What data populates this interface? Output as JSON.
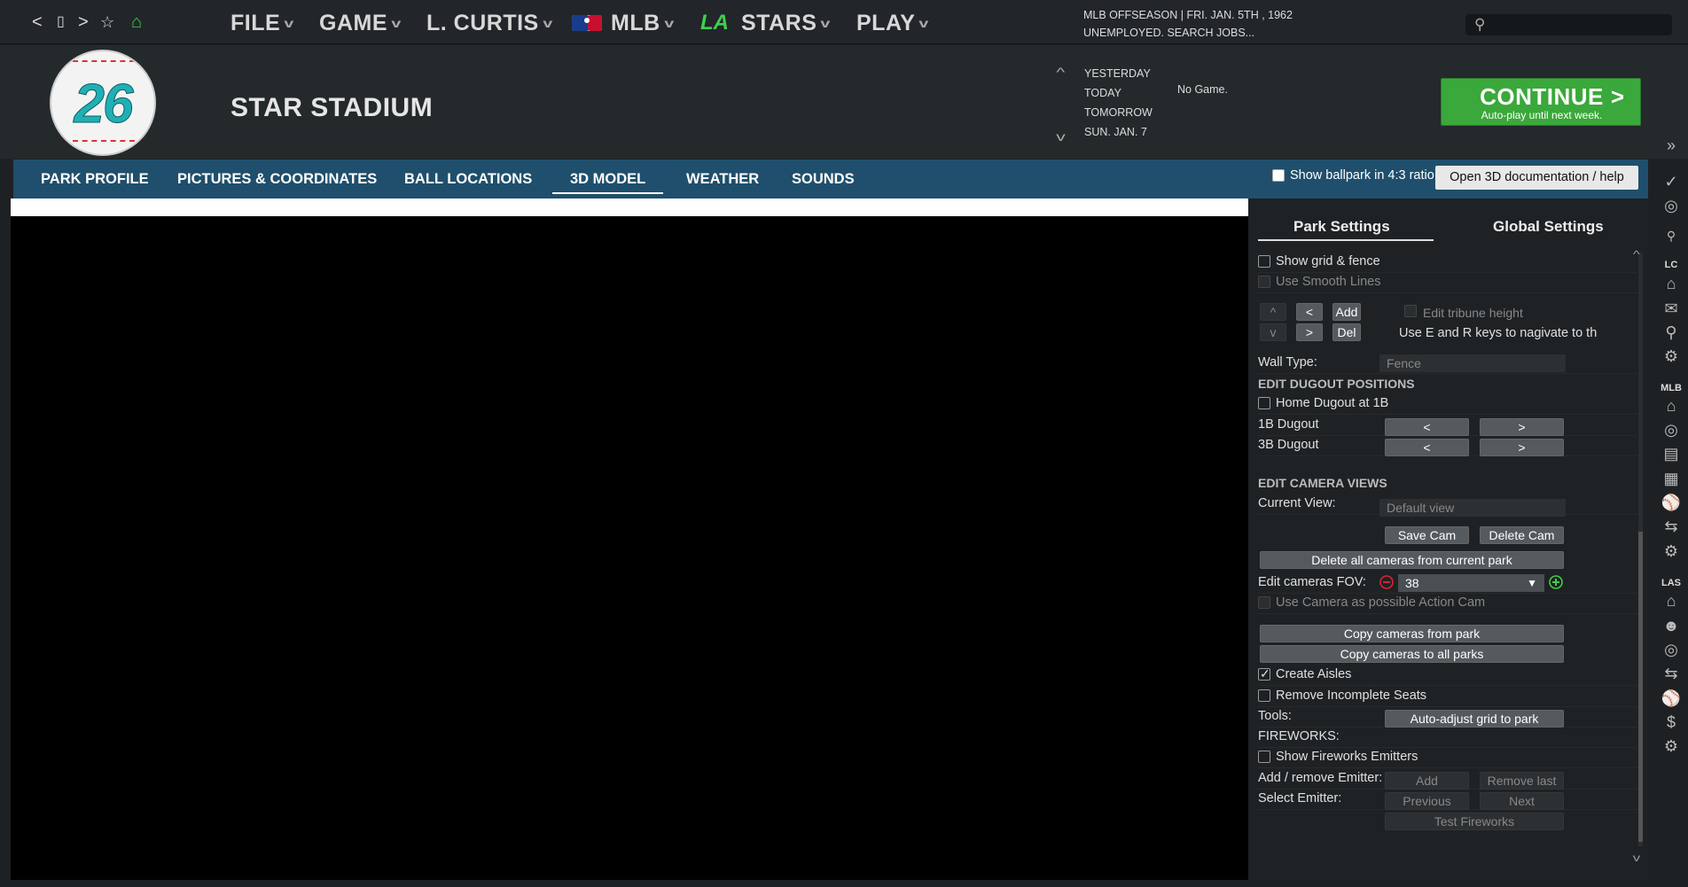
{
  "nav": {
    "back": "<",
    "page": "▯",
    "forward": ">",
    "fav": "☆",
    "home": "⌂"
  },
  "menus": {
    "file": "FILE",
    "game": "GAME",
    "manager": "L. CURTIS",
    "mlb": "MLB",
    "stars": "STARS",
    "play": "PLAY",
    "team_logo": "LA"
  },
  "status": {
    "line1": "MLB OFFSEASON | FRI. JAN. 5TH , 1962",
    "line2": "UNEMPLOYED. SEARCH JOBS..."
  },
  "search": {
    "placeholder": ""
  },
  "logo": {
    "number": "26"
  },
  "page_title": "STAR STADIUM",
  "schedule": {
    "yesterday": "YESTERDAY",
    "today": "TODAY",
    "tomorrow": "TOMORROW",
    "next": "SUN. JAN. 7",
    "today_value": "No Game."
  },
  "continue": {
    "label": "CONTINUE",
    "sub": "Auto-play until next week.",
    "arrow": ">"
  },
  "tabs": [
    "PARK PROFILE",
    "PICTURES & COORDINATES",
    "BALL LOCATIONS",
    "3D MODEL",
    "WEATHER",
    "SOUNDS"
  ],
  "ratio_label": "Show ballpark in 4:3 ratio",
  "doc_button": "Open 3D documentation / help",
  "panel": {
    "tab_park": "Park Settings",
    "tab_global": "Global Settings",
    "show_grid": "Show grid & fence",
    "smooth_lines": "Use Smooth Lines",
    "up": "^",
    "prev": "<",
    "add": "Add",
    "edit_tribune": "Edit tribune height",
    "down": "v",
    "next": ">",
    "del": "Del",
    "keys_hint": "Use E and R keys to nagivate to th",
    "wall_type": "Wall Type:",
    "wall_value": "Fence",
    "dugout_section": "EDIT DUGOUT POSITIONS",
    "home_dugout": "Home Dugout at 1B",
    "dugout_1b": "1B Dugout",
    "dugout_3b": "3B Dugout",
    "left": "<",
    "right": ">",
    "camera_section": "EDIT CAMERA VIEWS",
    "current_view": "Current View:",
    "current_view_value": "Default view",
    "save_cam": "Save Cam",
    "delete_cam": "Delete Cam",
    "delete_all": "Delete all cameras from current park",
    "fov_label": "Edit cameras FOV:",
    "fov_value": "38",
    "action_cam": "Use Camera as possible Action Cam",
    "copy_from": "Copy cameras from park",
    "copy_to": "Copy cameras to all parks",
    "create_aisles": "Create Aisles",
    "remove_seats": "Remove Incomplete Seats",
    "tools": "Tools:",
    "auto_adjust": "Auto-adjust grid to park",
    "fireworks": "FIREWORKS:",
    "show_emitters": "Show Fireworks Emitters",
    "add_remove": "Add / remove Emitter:",
    "add_btn": "Add",
    "remove_last": "Remove last",
    "select_emitter": "Select Emitter:",
    "previous": "Previous",
    "next_btn": "Next",
    "test": "Test Fireworks"
  },
  "right_labels": {
    "lc": "LC",
    "mlb": "MLB",
    "las": "LAS"
  },
  "colors": {
    "accent_tab_bar": "#1f4f6c",
    "continue_green": "#3aa83a",
    "logo_teal": "#1fb0b4"
  }
}
